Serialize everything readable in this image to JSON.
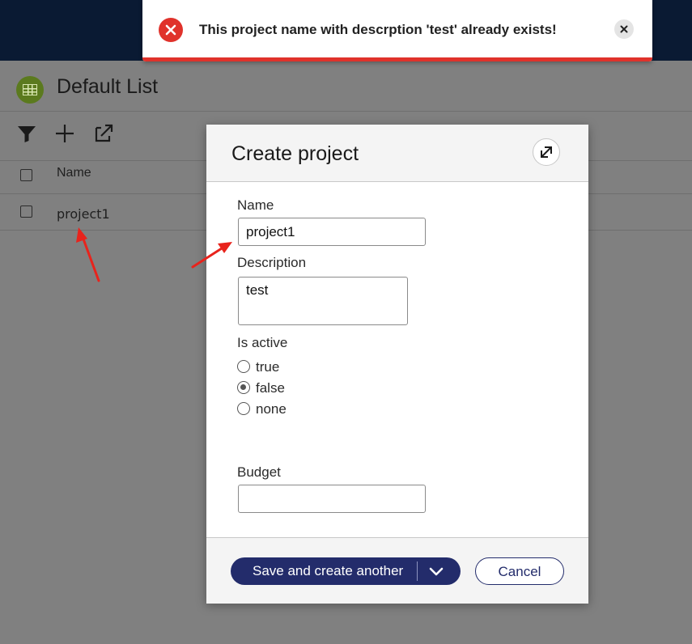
{
  "page": {
    "title": "Default List",
    "table": {
      "header_name": "Name",
      "rows": [
        {
          "name": "project1"
        }
      ]
    },
    "toolbar": {
      "filter_icon": "filter-icon",
      "add_icon": "plus-icon",
      "export_icon": "export-icon"
    }
  },
  "toast": {
    "message": "This project name with descrption 'test' already exists!",
    "accent": "#e0322b"
  },
  "dialog": {
    "title": "Create project",
    "fields": {
      "name_label": "Name",
      "name_value": "project1",
      "description_label": "Description",
      "description_value": "test",
      "is_active_label": "Is active",
      "options": [
        "true",
        "false",
        "none"
      ],
      "selected_option": "false",
      "budget_label": "Budget",
      "budget_value": ""
    },
    "footer": {
      "save_label": "Save and create another",
      "cancel_label": "Cancel"
    },
    "brand_color": "#232c6b"
  }
}
